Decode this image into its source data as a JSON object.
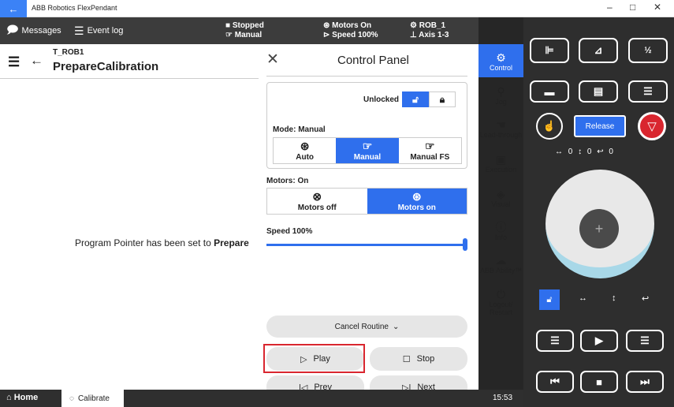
{
  "window": {
    "title": "ABB Robotics FlexPendant",
    "back": "←",
    "min": "–",
    "max": "□",
    "close": "✕"
  },
  "topbar": {
    "messages": "Messages",
    "eventlog": "Event log",
    "state1": "Stopped",
    "state2": "Manual",
    "motors1": "Motors On",
    "motors2": "Speed 100%",
    "rob1": "ROB_1",
    "rob2": "Axis 1-3",
    "more": "···"
  },
  "header": {
    "task": "T_ROB1",
    "routine": "PrepareCalibration"
  },
  "main": {
    "pointer_msg_prefix": "Program Pointer has been set to ",
    "pointer_msg_bold": "Prepare"
  },
  "control_panel": {
    "title": "Control Panel",
    "unlocked": "Unlocked",
    "mode_label": "Mode: Manual",
    "modes": [
      "Auto",
      "Manual",
      "Manual FS"
    ],
    "motors_label": "Motors: On",
    "motors": [
      "Motors off",
      "Motors on"
    ],
    "speed_label": "Speed 100%",
    "speed_value": 100,
    "cancel": "Cancel Routine",
    "play": "Play",
    "stop": "Stop",
    "prev": "Prev",
    "next": "Next"
  },
  "sidebar": {
    "items": [
      "Control",
      "Jog",
      "Lead-through",
      "Execution",
      "Visual",
      "Info",
      "ABB Ability™",
      "Logout/",
      "Restart"
    ]
  },
  "bottom": {
    "home": "Home",
    "calibrate": "Calibrate",
    "time": "15:53"
  },
  "right": {
    "release": "Release",
    "motion": "↔ 0 ↕ 0 ↩ 0"
  },
  "colors": {
    "accent": "#2f6fed",
    "highlight": "#d9262f"
  }
}
